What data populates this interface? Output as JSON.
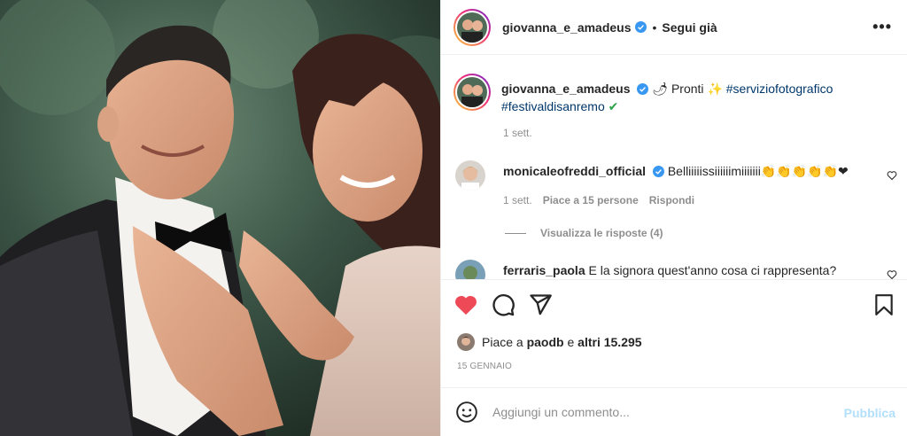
{
  "post": {
    "author": "giovanna_e_amadeus",
    "follow_status": "Segui già",
    "separator": "•",
    "more": "•••"
  },
  "caption": {
    "username": "giovanna_e_amadeus",
    "text_emoji1": "🌶",
    "text": "Pronti",
    "text_emoji2": "✨",
    "hashtag1": "#serviziofotografico",
    "hashtag2": "#festivaldisanremo",
    "text_emoji3": "✔",
    "time": "1 sett."
  },
  "comments": [
    {
      "username": "monicaleofreddi_official",
      "text": "Belliiiiissiiiiiimiiiiiii👏👏👏👏👏❤",
      "time": "1 sett.",
      "likes": "Piace a 15 persone",
      "reply": "Rispondi",
      "view_replies": "Visualizza le risposte (4)"
    },
    {
      "username": "ferraris_paola",
      "text": "E la signora quest'anno cosa ci rappresenta?"
    }
  ],
  "likes_summary": {
    "prefix": "Piace a",
    "user": "paodb",
    "middle": "e",
    "others": "altri 15.295"
  },
  "date": "15 GENNAIO",
  "comment_box": {
    "placeholder": "Aggiungi un commento...",
    "publish": "Pubblica"
  },
  "colors": {
    "like_red": "#ed4956",
    "link_blue": "#00376b",
    "verified_blue": "#3897f0",
    "publish_disabled": "#b2dffc"
  },
  "icons": [
    "heart-icon",
    "comment-icon",
    "share-icon",
    "bookmark-icon",
    "emoji-icon",
    "verified-icon",
    "more-icon"
  ]
}
